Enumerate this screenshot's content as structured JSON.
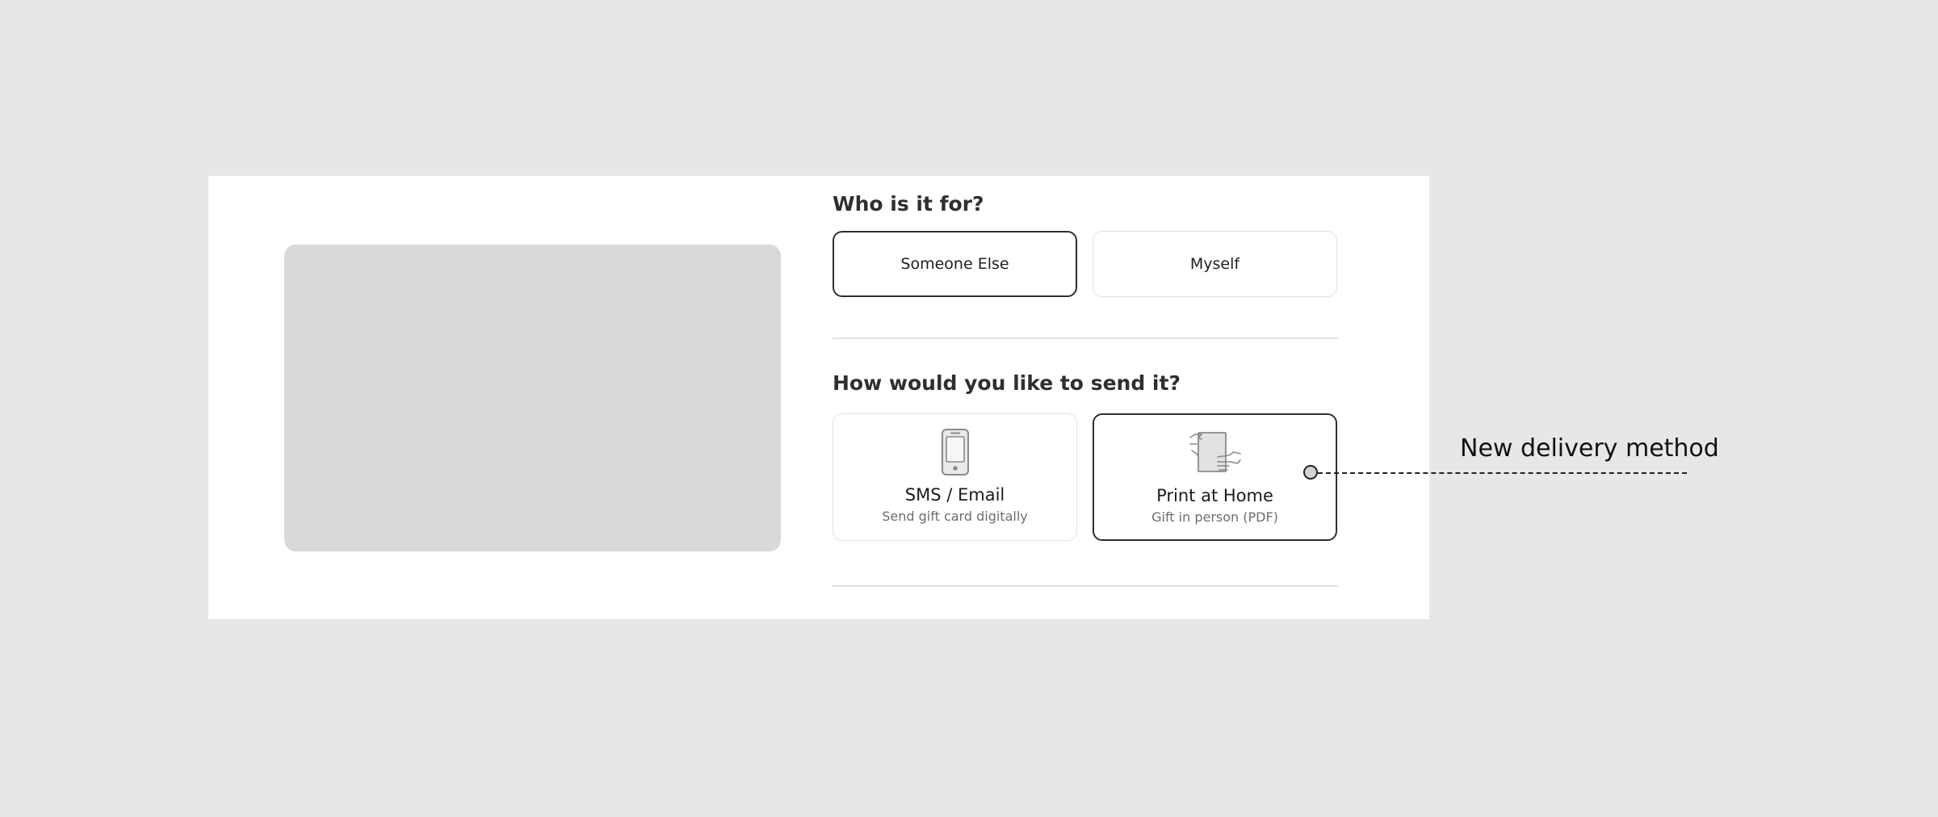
{
  "recipient": {
    "title": "Who is it for?",
    "options": [
      {
        "label": "Someone Else",
        "selected": true
      },
      {
        "label": "Myself",
        "selected": false
      }
    ]
  },
  "delivery": {
    "title": "How would you like to send it?",
    "options": [
      {
        "icon": "phone-icon",
        "label": "SMS / Email",
        "sub": "Send gift card digitally",
        "selected": false
      },
      {
        "icon": "print-document-icon",
        "label": "Print at Home",
        "sub": "Gift in person (PDF)",
        "selected": true
      }
    ]
  },
  "annotation": {
    "text": "New delivery method"
  },
  "colors": {
    "background": "#e7e7e7",
    "panel": "#ffffff",
    "image_placeholder": "#d9d9d9",
    "selected_border": "#2f2f2f",
    "unselected_border": "#e3e3e3"
  }
}
